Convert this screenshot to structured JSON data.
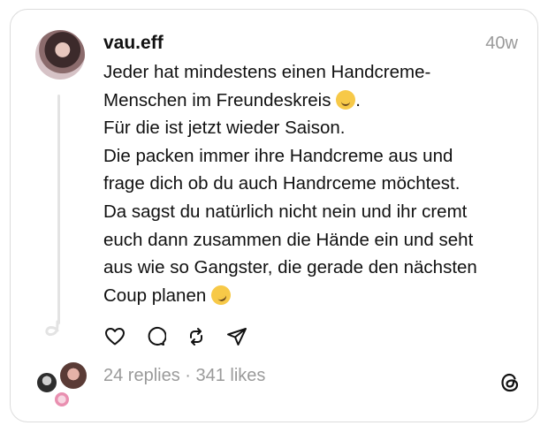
{
  "post": {
    "username": "vau.eff",
    "time": "40w",
    "lines": [
      "Jeder hat mindestens einen Handcreme-",
      "Menschen im Freundeskreis",
      "Für die ist jetzt wieder Saison.",
      "Die packen immer ihre Handcreme aus und",
      "frage dich ob du auch Handrceme möchtest.",
      "Da sagst du natürlich nicht nein und ihr cremt",
      "euch dann zusammen die Hände ein und seht",
      "aus wie so Gangster, die gerade den nächsten",
      "Coup planen"
    ],
    "emojis": [
      "relieved-face-emoji",
      "rolling-on-floor-laughing-emoji"
    ],
    "period_after_emoji": "."
  },
  "actions": {
    "icons": [
      "heart-icon",
      "comment-icon",
      "repost-icon",
      "share-icon"
    ]
  },
  "footer": {
    "stats": "24 replies · 341 likes",
    "logo": "threads-logo-icon"
  }
}
